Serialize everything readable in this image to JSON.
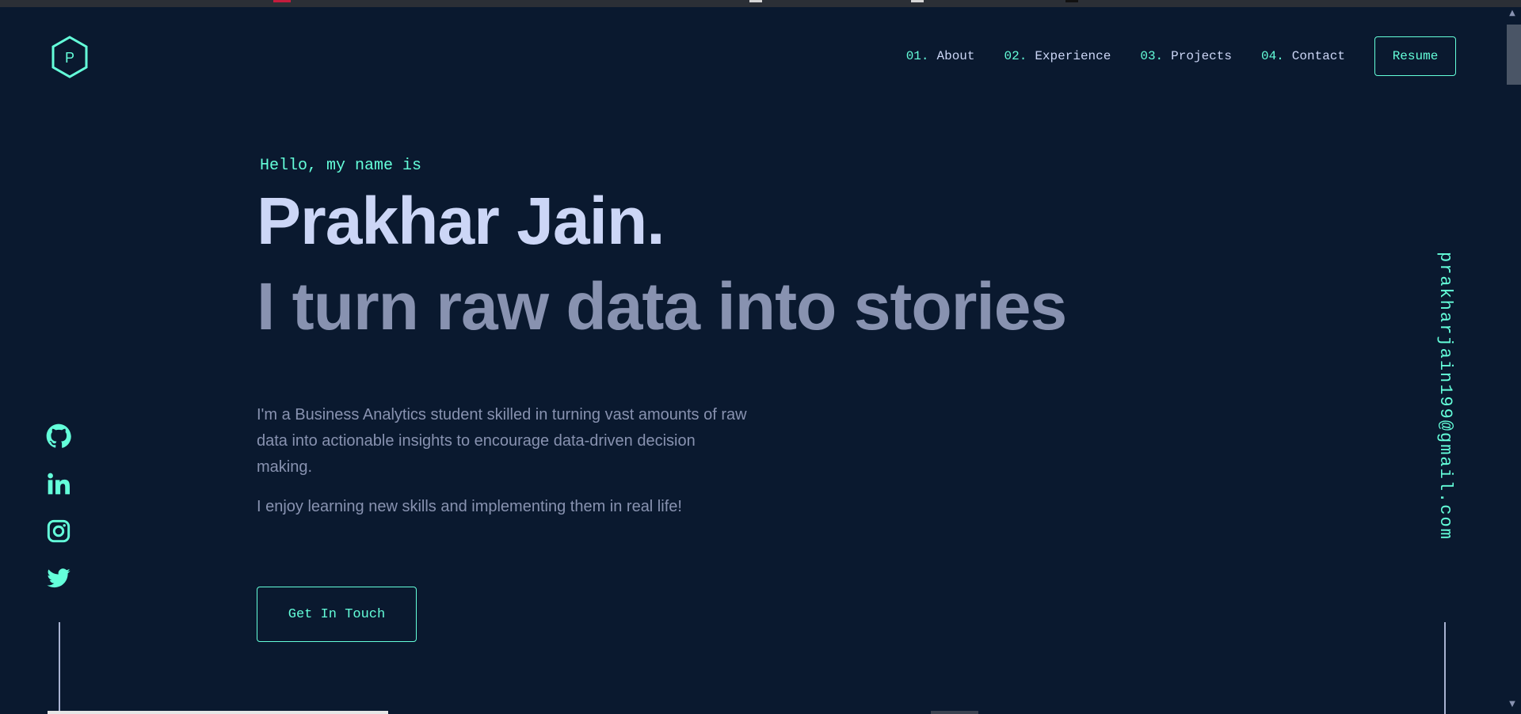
{
  "nav": {
    "logo_letter": "P",
    "items": [
      {
        "num": "01.",
        "label": "About"
      },
      {
        "num": "02.",
        "label": "Experience"
      },
      {
        "num": "03.",
        "label": "Projects"
      },
      {
        "num": "04.",
        "label": "Contact"
      }
    ],
    "resume_label": "Resume"
  },
  "hero": {
    "greeting": "Hello, my name is",
    "name": "Prakhar Jain.",
    "tagline": "I turn raw data into stories",
    "bio": [
      "I'm a Business Analytics student skilled in turning vast amounts of raw data into actionable insights to encourage data-driven decision making.",
      "I enjoy learning new skills and implementing them in real life!"
    ],
    "cta_label": "Get In Touch"
  },
  "social": {
    "icons": [
      "github-icon",
      "linkedin-icon",
      "instagram-icon",
      "twitter-icon"
    ]
  },
  "email": "prakharjain199@gmail.com",
  "colors": {
    "background": "#0a192f",
    "accent": "#64ffda",
    "heading": "#ccd6f6",
    "muted": "#8892b0"
  }
}
